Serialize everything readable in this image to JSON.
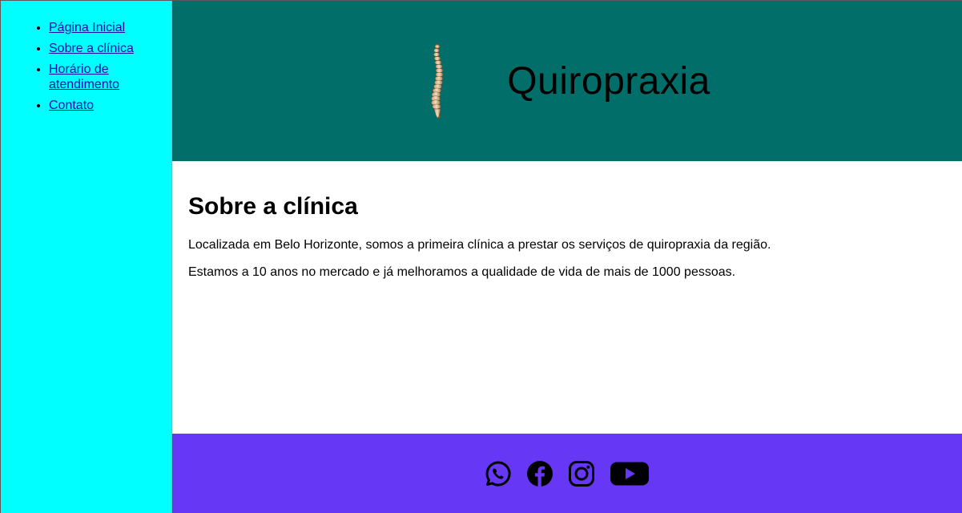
{
  "sidebar": {
    "items": [
      {
        "label": "Página Inicial"
      },
      {
        "label": "Sobre a clínica"
      },
      {
        "label": "Horário de atendimento"
      },
      {
        "label": "Contato"
      }
    ]
  },
  "header": {
    "title": "Quiropraxia",
    "logo_icon": "spine-icon"
  },
  "main": {
    "heading": "Sobre a clínica",
    "paragraphs": [
      "Localizada em Belo Horizonte, somos a primeira clínica a prestar os serviços de quiropraxia da região.",
      "Estamos a 10 anos no mercado e já melhoramos a qualidade de vida de mais de 1000 pessoas."
    ]
  },
  "footer": {
    "social_icons": [
      "whatsapp-icon",
      "facebook-icon",
      "instagram-icon",
      "youtube-icon"
    ]
  },
  "colors": {
    "sidebar_bg": "#00ffff",
    "header_bg": "#026e6a",
    "footer_bg": "#6637f5",
    "link": "#1a0dab"
  }
}
